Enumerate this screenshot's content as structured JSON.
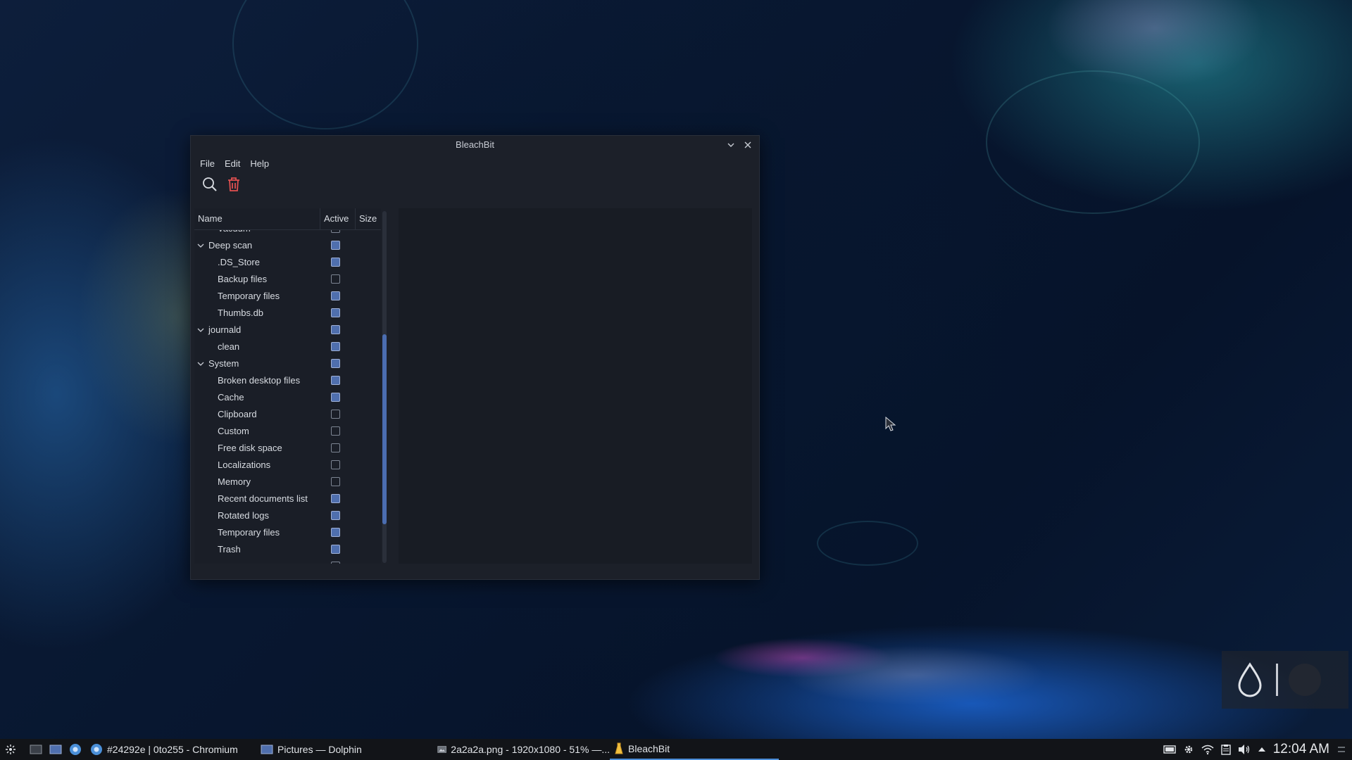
{
  "window": {
    "title": "BleachBit",
    "menu": [
      "File",
      "Edit",
      "Help"
    ],
    "columns": {
      "name": "Name",
      "active": "Active",
      "size": "Size"
    }
  },
  "tree": [
    {
      "label": "Vacuum",
      "level": 1,
      "checked": false,
      "partial": true
    },
    {
      "label": "Deep scan",
      "level": 0,
      "checked": true,
      "expanded": true
    },
    {
      "label": ".DS_Store",
      "level": 1,
      "checked": true
    },
    {
      "label": "Backup files",
      "level": 1,
      "checked": false
    },
    {
      "label": "Temporary files",
      "level": 1,
      "checked": true
    },
    {
      "label": "Thumbs.db",
      "level": 1,
      "checked": true
    },
    {
      "label": "journald",
      "level": 0,
      "checked": true,
      "expanded": true
    },
    {
      "label": "clean",
      "level": 1,
      "checked": true
    },
    {
      "label": "System",
      "level": 0,
      "checked": true,
      "expanded": true
    },
    {
      "label": "Broken desktop files",
      "level": 1,
      "checked": true
    },
    {
      "label": "Cache",
      "level": 1,
      "checked": true
    },
    {
      "label": "Clipboard",
      "level": 1,
      "checked": false
    },
    {
      "label": "Custom",
      "level": 1,
      "checked": false
    },
    {
      "label": "Free disk space",
      "level": 1,
      "checked": false
    },
    {
      "label": "Localizations",
      "level": 1,
      "checked": false
    },
    {
      "label": "Memory",
      "level": 1,
      "checked": false
    },
    {
      "label": "Recent documents list",
      "level": 1,
      "checked": true
    },
    {
      "label": "Rotated logs",
      "level": 1,
      "checked": true
    },
    {
      "label": "Temporary files",
      "level": 1,
      "checked": true
    },
    {
      "label": "Trash",
      "level": 1,
      "checked": true
    }
  ],
  "taskbar": {
    "tasks": [
      {
        "label": "#24292e | 0to255 - Chromium",
        "icon": "chromium-icon"
      },
      {
        "label": "Pictures — Dolphin",
        "icon": "dolphin-icon"
      },
      {
        "label": "2a2a2a.png - 1920x1080 - 51% —...",
        "icon": "image-viewer-icon"
      },
      {
        "label": "BleachBit",
        "icon": "bleachbit-icon",
        "active": true
      }
    ],
    "clock": "12:04 AM"
  },
  "colors": {
    "accent": "#4f6fae",
    "trash": "#e05050",
    "taskbar_active": "#4b8dd8"
  }
}
